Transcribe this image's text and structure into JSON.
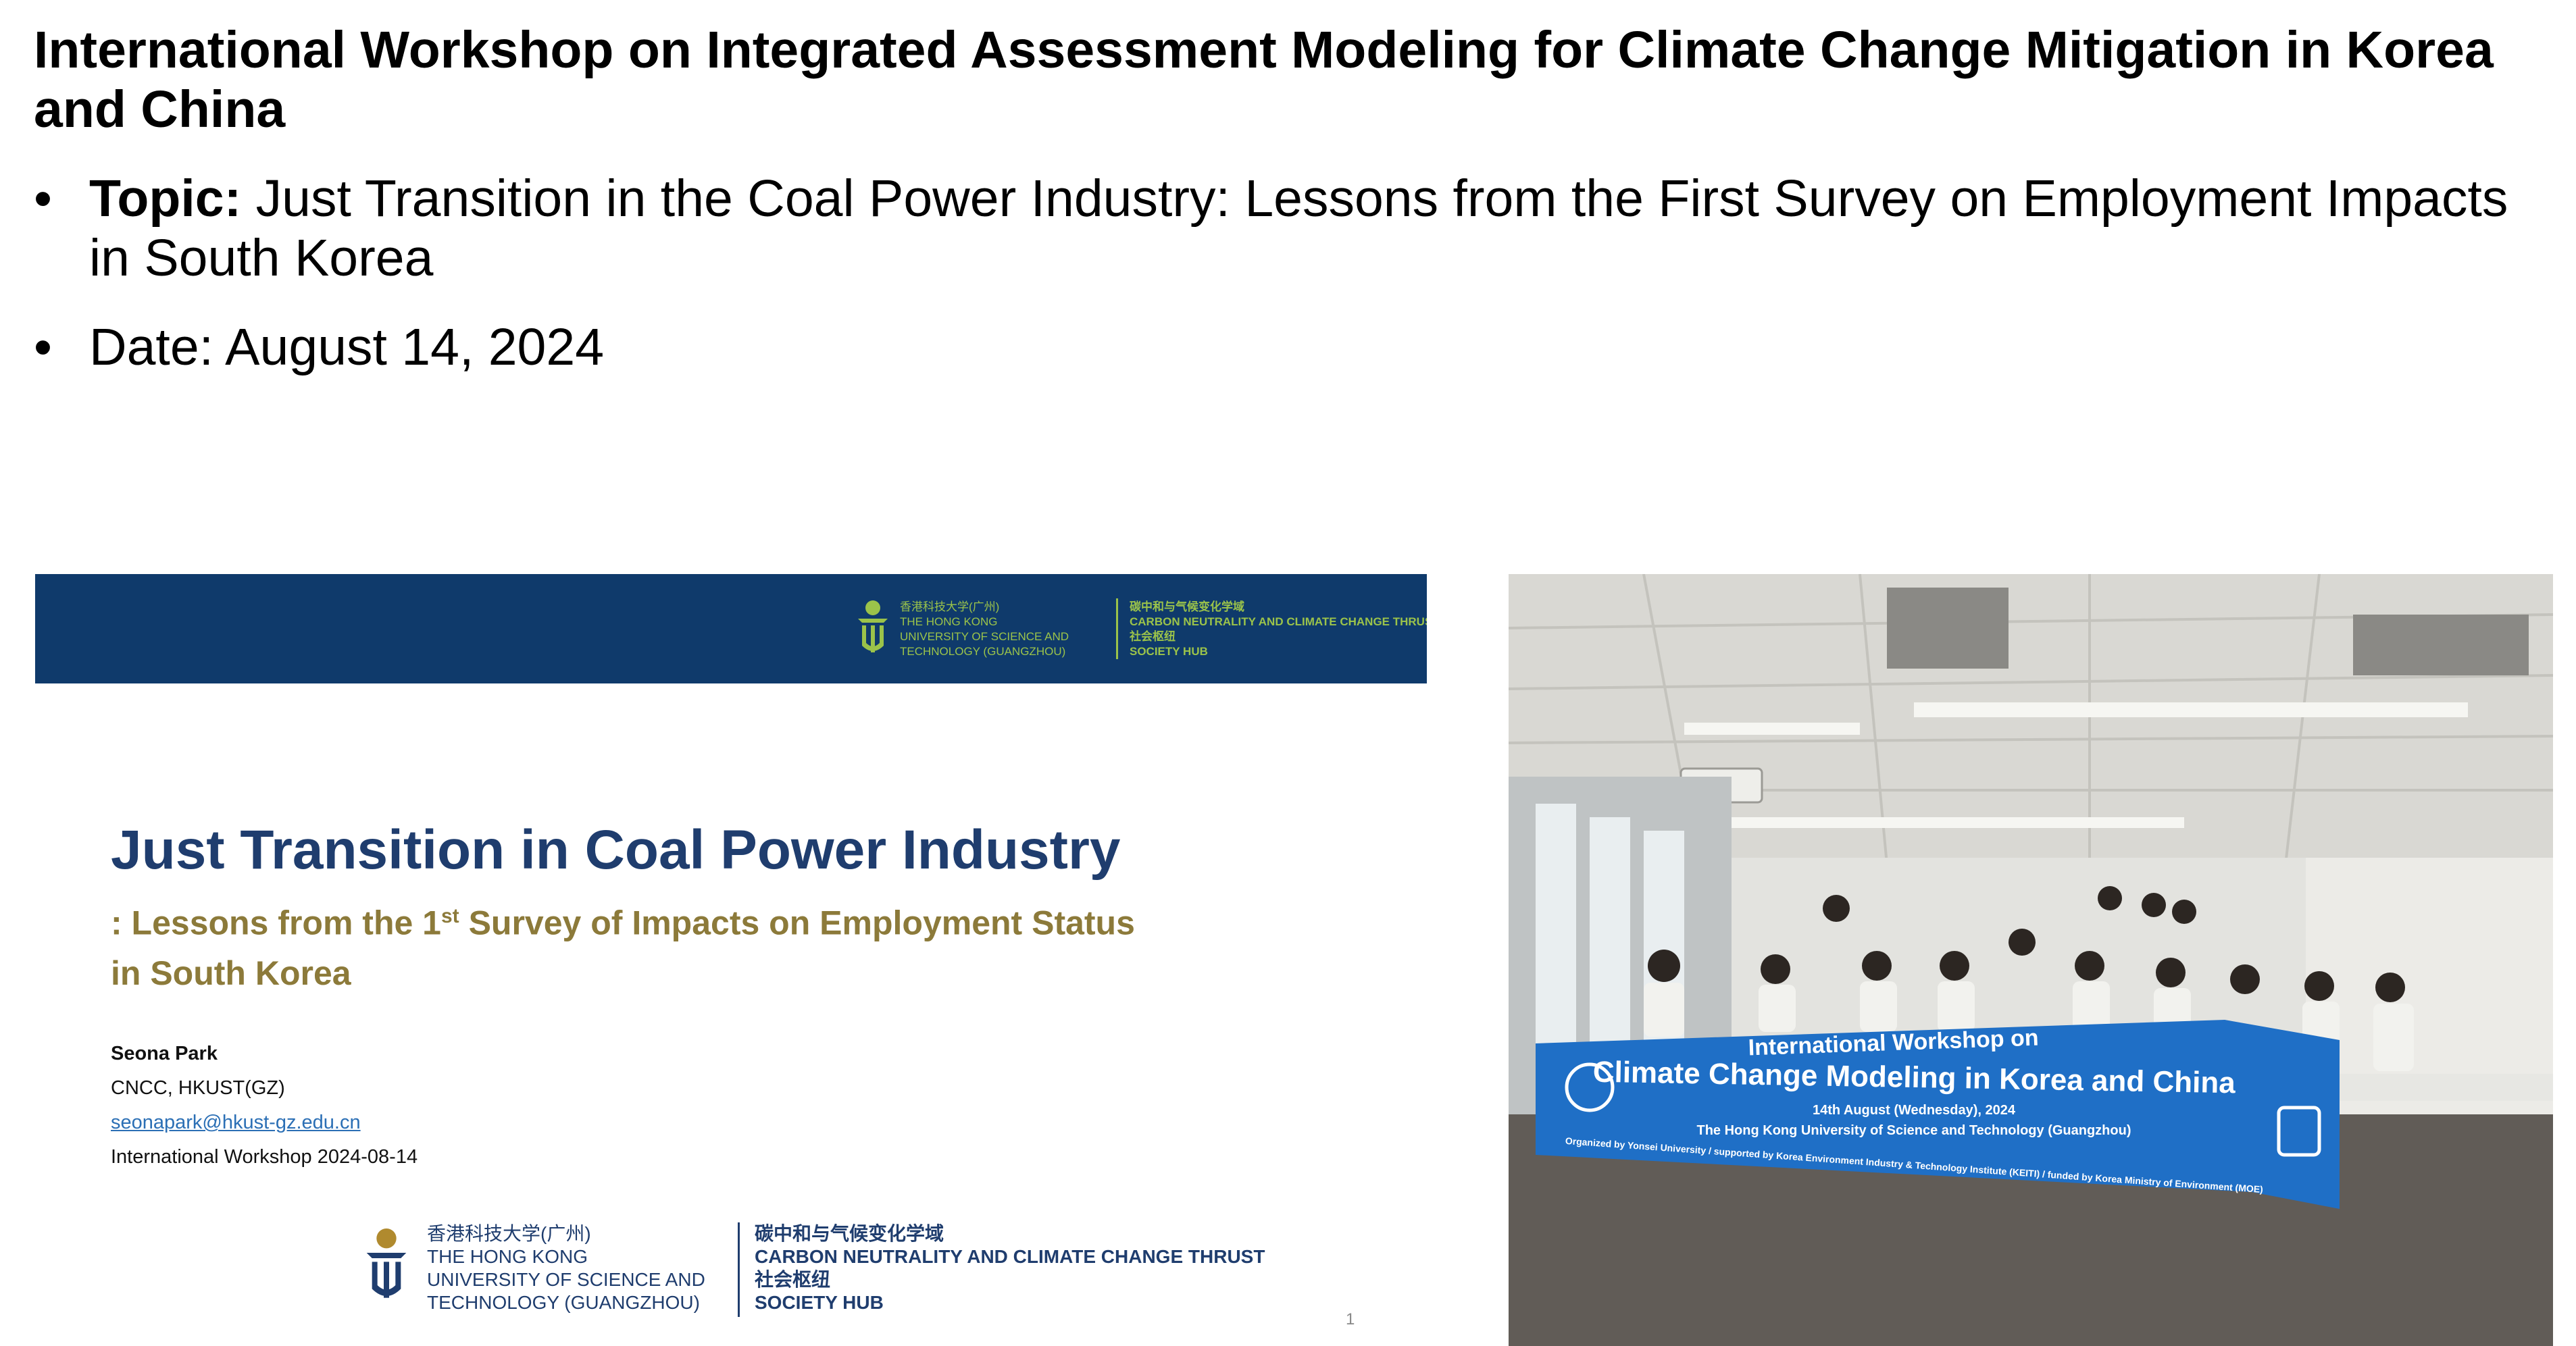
{
  "page": {
    "title": "International Workshop on Integrated Assessment Modeling for Climate Change Mitigation in Korea and China",
    "bullets": [
      {
        "bold": "Topic:",
        "text": " Just Transition in the Coal Power Industry: Lessons from the First Survey on Employment Impacts in South Korea"
      },
      {
        "bold": "",
        "text": "Date: August 14, 2024"
      }
    ],
    "bullet_glyph": "•"
  },
  "slide": {
    "header_uni": "香港科技大学(广州)\nTHE HONG KONG\nUNIVERSITY OF SCIENCE AND\nTECHNOLOGY (GUANGZHOU)",
    "header_thrust": "碳中和与气候变化学域\nCARBON NEUTRALITY AND CLIMATE CHANGE THRUST\n社会枢纽\nSOCIETY HUB",
    "title": "Just Transition in Coal Power Industry",
    "subtitle_line1_pre": ": Lessons from the 1",
    "subtitle_sup": "st",
    "subtitle_line1_post": " Survey of Impacts on Employment Status",
    "subtitle_line2": "in South Korea",
    "author_name": "Seona Park",
    "affiliation": "CNCC, HKUST(GZ)",
    "email": "seonapark@hkust-gz.edu.cn",
    "event": "International Workshop 2024-08-14",
    "footer_uni": "香港科技大学(广州)\nTHE HONG KONG\nUNIVERSITY OF SCIENCE AND\nTECHNOLOGY (GUANGZHOU)",
    "footer_thrust": "碳中和与气候变化学域\nCARBON NEUTRALITY AND CLIMATE CHANGE THRUST\n社会枢纽\nSOCIETY HUB",
    "page_number": "1"
  },
  "photo": {
    "banner_line1": "International Workshop on",
    "banner_line2": "Climate Change Modeling in Korea and China",
    "banner_line3": "14th August (Wednesday), 2024",
    "banner_line4": "The Hong Kong University of Science and Technology (Guangzhou)",
    "banner_line5": "Organized by Yonsei University / supported by Korea Environment Industry & Technology Institute (KEITI) / funded by Korea Ministry of Environment (MOE)"
  },
  "colors": {
    "slide_header": "#0f3a6b",
    "slide_title": "#1f3d6e",
    "slide_subtitle": "#8c7a3a",
    "logo_green": "#9bc34a",
    "banner_blue": "#1f6fc6"
  }
}
